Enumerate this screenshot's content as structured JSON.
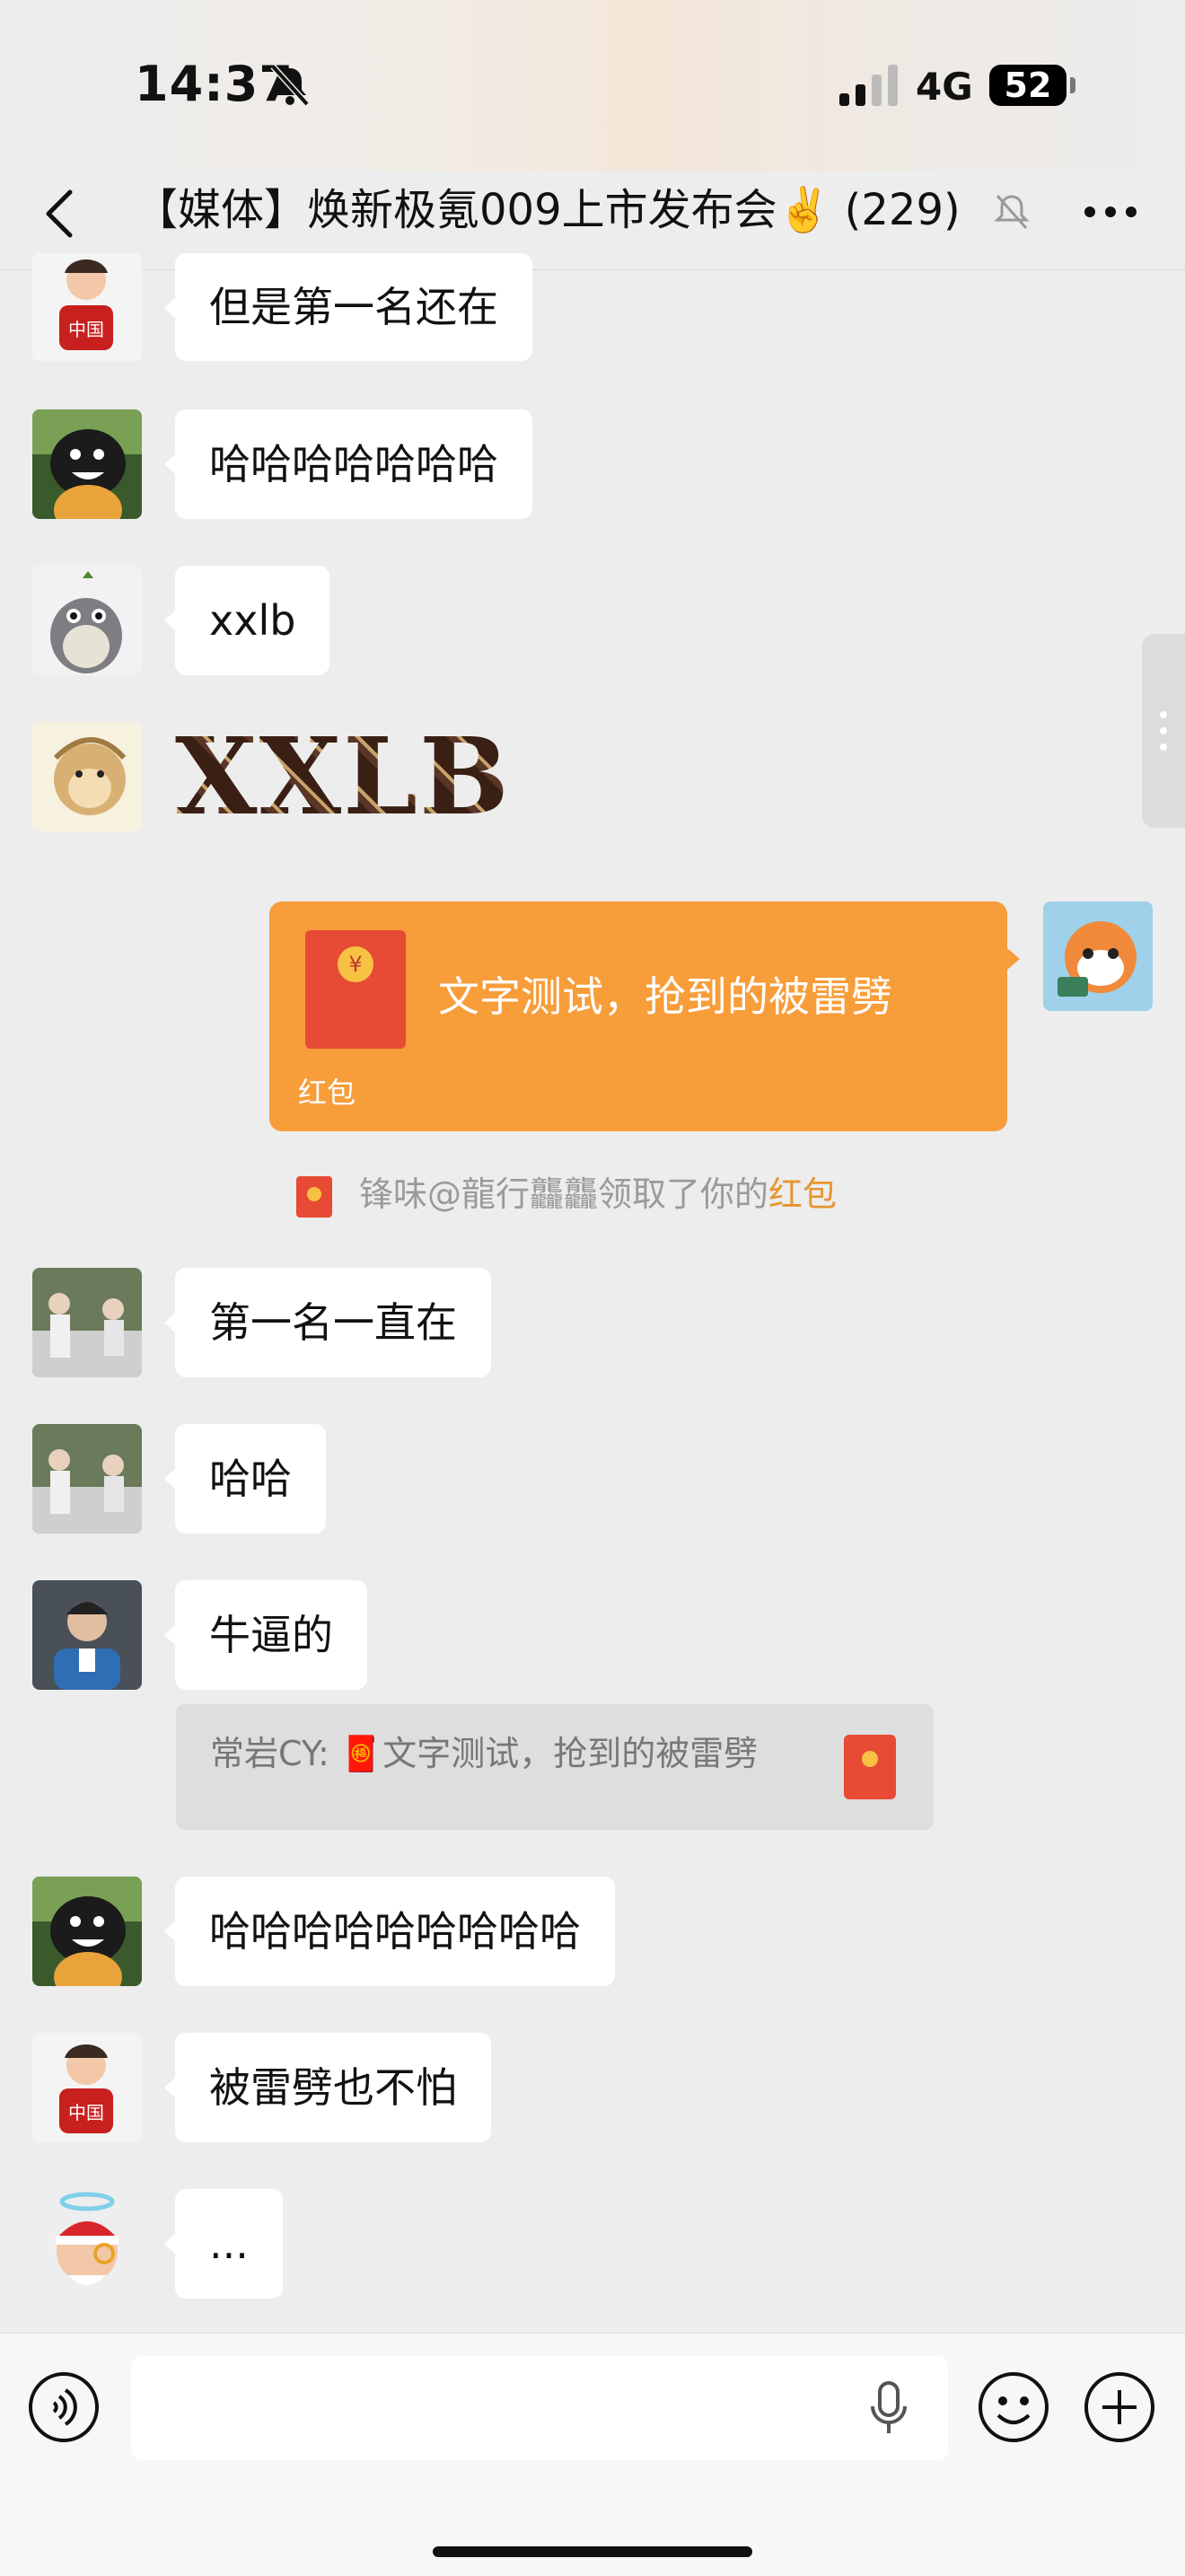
{
  "status_bar": {
    "time": "14:37",
    "network": "4G",
    "battery": "52"
  },
  "header": {
    "title": "【媒体】焕新极氪009上市发布会✌️ (229)",
    "back_icon": "chevron-left-icon",
    "more_icon": "more-icon",
    "mute_icon": "bell-off-icon"
  },
  "messages": [
    {
      "text": "但是第一名还在"
    },
    {
      "text": "哈哈哈哈哈哈哈"
    },
    {
      "text": "xxlb"
    },
    {
      "sticker_text": "XXLB"
    },
    {
      "red_packet": {
        "message": "文字测试，抢到的被雷劈",
        "label": "红包"
      }
    },
    {
      "system": {
        "prefix": "锋味@龍行龘龘领取了你的",
        "link": "红包"
      }
    },
    {
      "text": "第一名一直在"
    },
    {
      "text": "哈哈"
    },
    {
      "text": "牛逼的",
      "quote": "常岩CY: 🧧文字测试，抢到的被雷劈"
    },
    {
      "text": "哈哈哈哈哈哈哈哈哈"
    },
    {
      "text": "被雷劈也不怕"
    },
    {
      "text": "..."
    }
  ],
  "input_bar": {
    "voice_icon": "voice-icon",
    "mic_icon": "microphone-icon",
    "emoji_icon": "emoji-icon",
    "plus_icon": "plus-icon"
  },
  "colors": {
    "background": "#ededed",
    "bubble": "#ffffff",
    "red_packet": "#f79d3a",
    "link": "#e7952f"
  }
}
